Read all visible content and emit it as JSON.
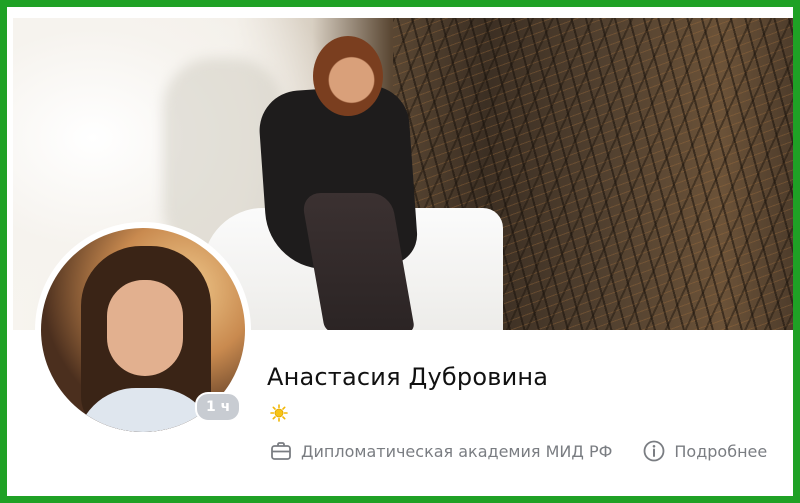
{
  "profile": {
    "name": "Анастасия Дубровина",
    "status_icon": "sun-icon",
    "online_badge": "1 ч",
    "workplace": "Дипломатическая академия МИД РФ",
    "more_label": "Подробнее"
  },
  "icons": {
    "workplace": "briefcase-icon",
    "more": "info-icon"
  },
  "colors": {
    "frame": "#1fa125",
    "text_primary": "#111111",
    "text_secondary": "#7a7d82",
    "badge_bg": "#c8ccd2",
    "sun": "#f2b705"
  }
}
